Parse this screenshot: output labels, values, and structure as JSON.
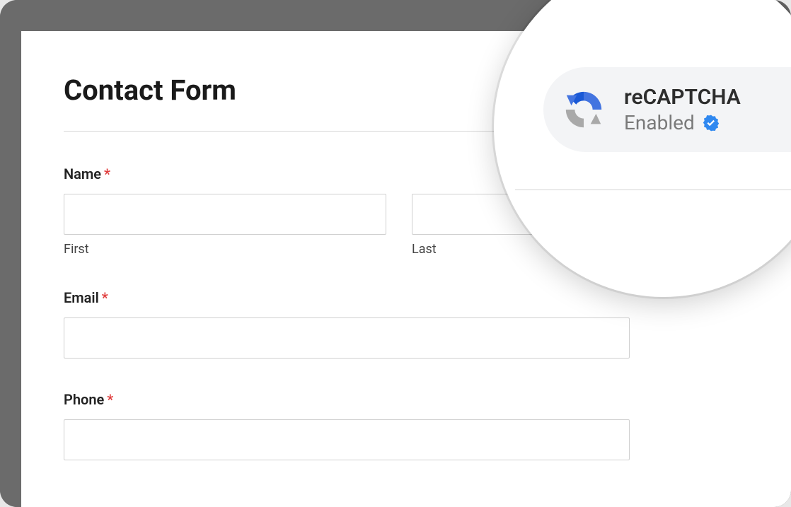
{
  "title": "Contact Form",
  "fields": {
    "name": {
      "label": "Name",
      "required_marker": "*",
      "first_sublabel": "First",
      "last_sublabel": "Last"
    },
    "email": {
      "label": "Email",
      "required_marker": "*"
    },
    "phone": {
      "label": "Phone",
      "required_marker": "*"
    }
  },
  "badge": {
    "title": "reCAPTCHA",
    "status": "Enabled"
  }
}
